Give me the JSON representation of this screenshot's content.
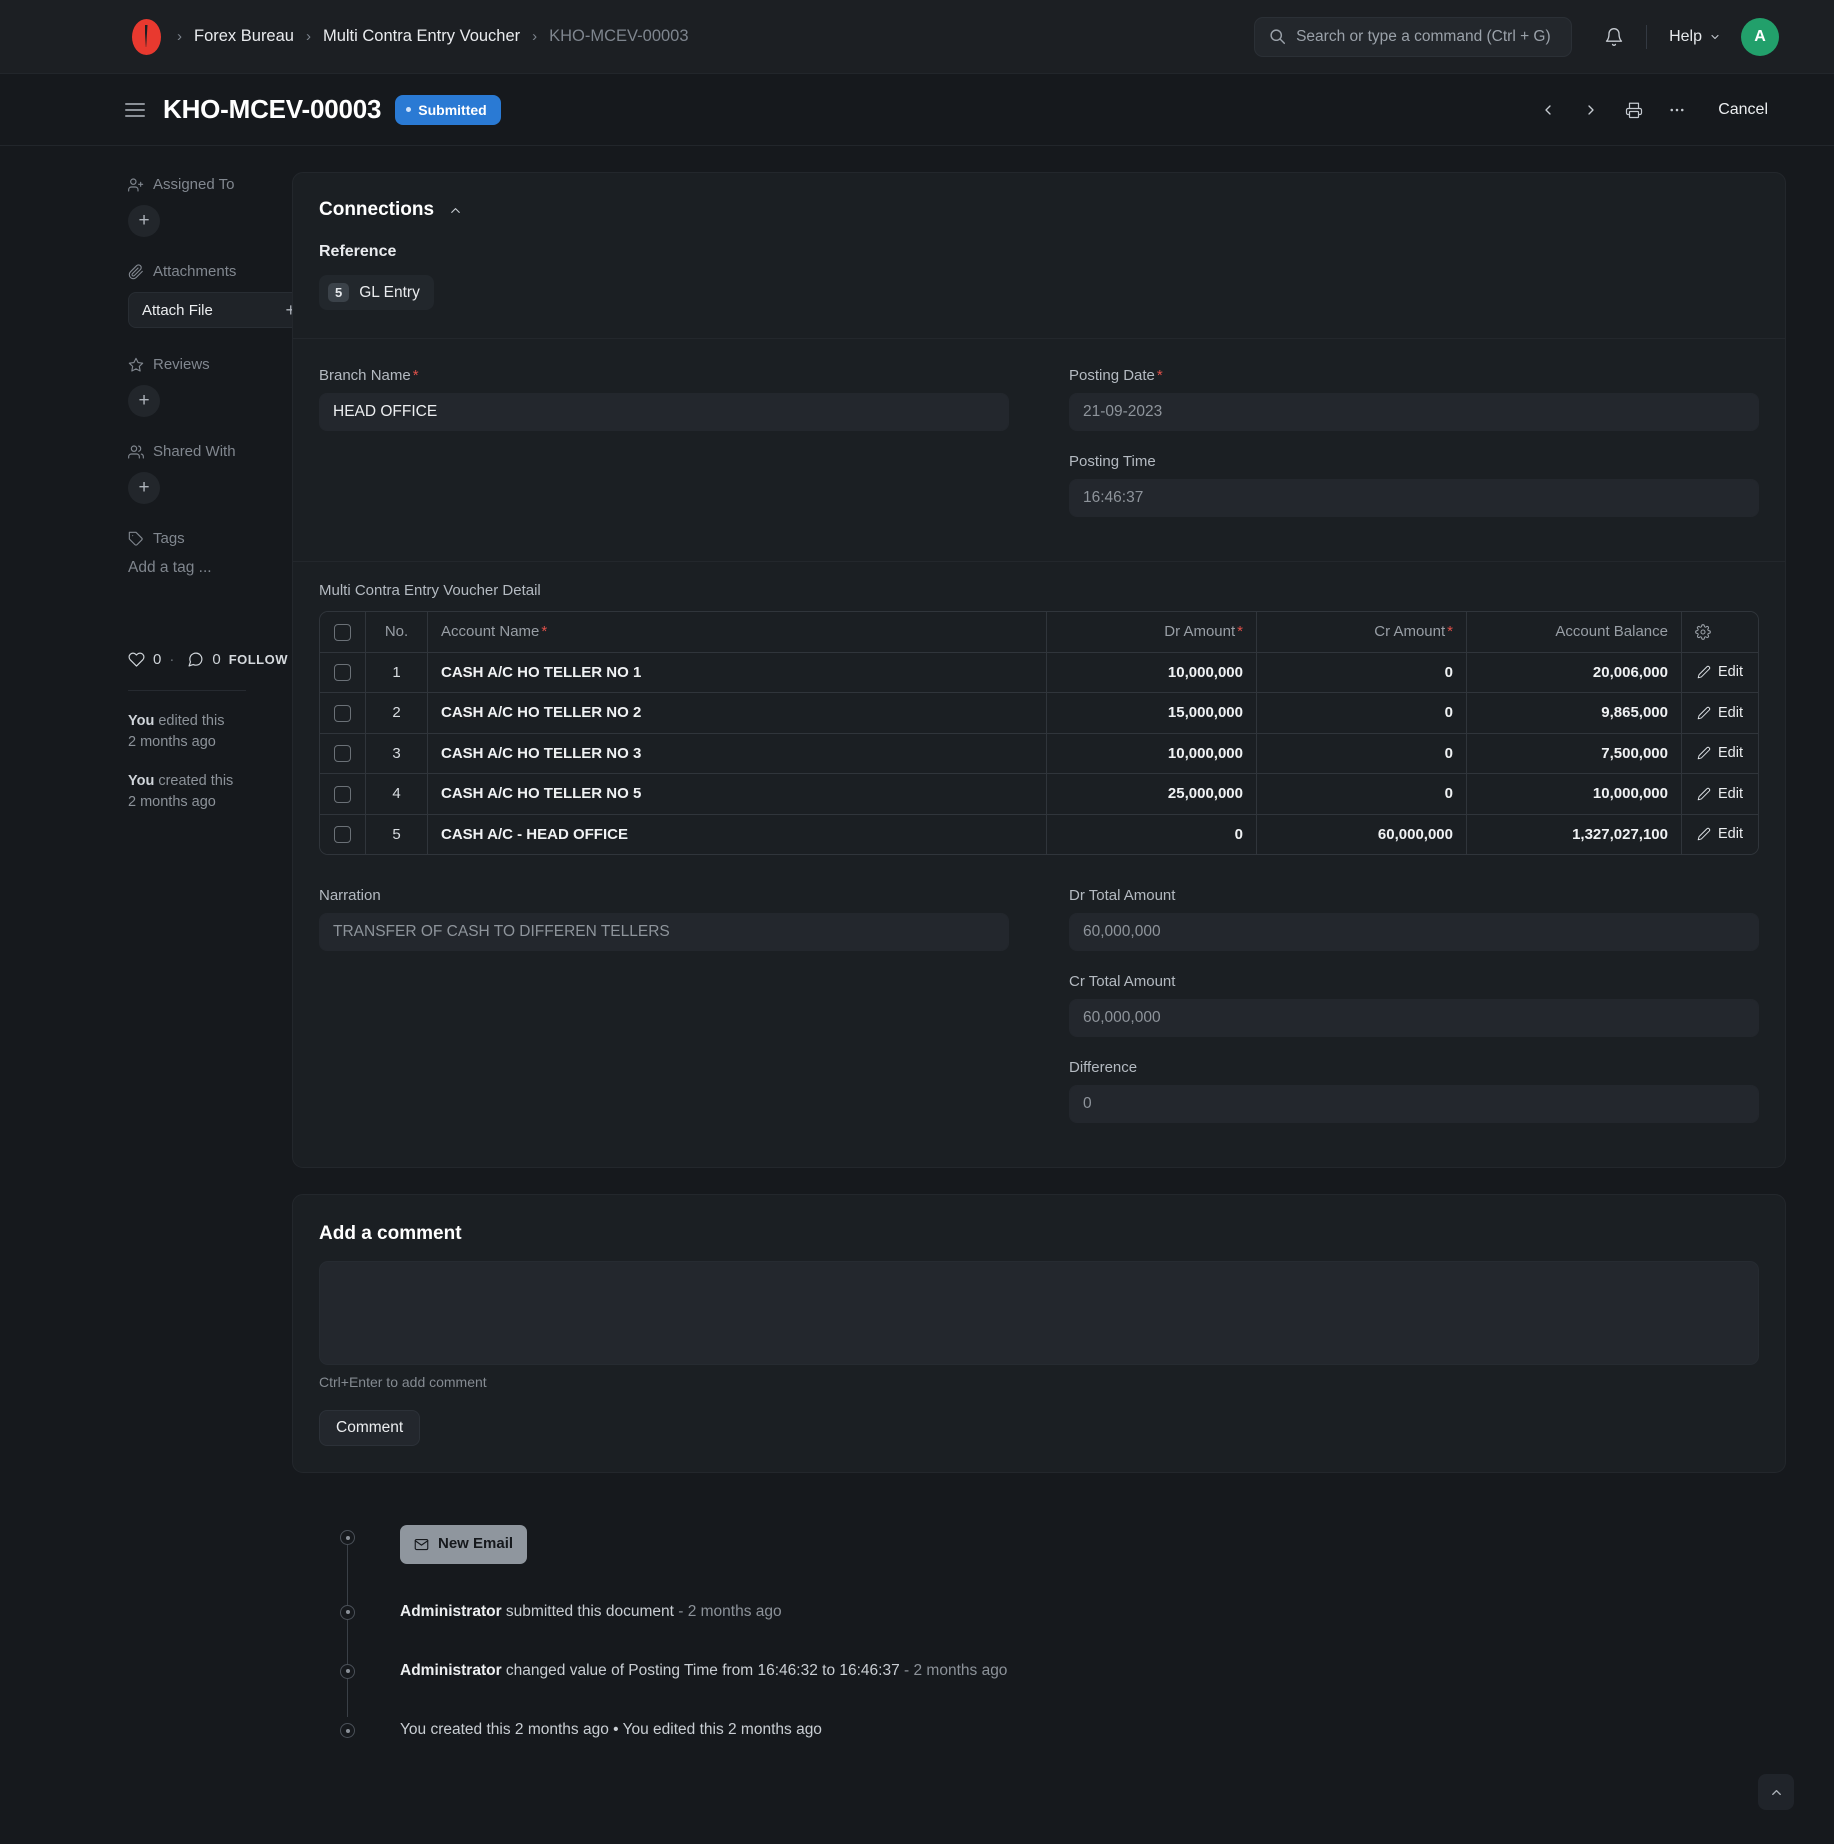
{
  "navbar": {
    "logo_alt": "frappe-logo",
    "breadcrumb": [
      {
        "label": "Forex Bureau",
        "current": false
      },
      {
        "label": "Multi Contra Entry Voucher",
        "current": false
      },
      {
        "label": "KHO-MCEV-00003",
        "current": true
      }
    ],
    "search": {
      "placeholder": "Search or type a command (Ctrl + G)",
      "value": ""
    },
    "help_label": "Help",
    "avatar_initial": "A"
  },
  "page_head": {
    "title": "KHO-MCEV-00003",
    "status": "Submitted",
    "status_color": "#2a7ad4",
    "cancel_label": "Cancel"
  },
  "sidebar": {
    "assigned_to_label": "Assigned To",
    "attachments_label": "Attachments",
    "attach_file_label": "Attach File",
    "reviews_label": "Reviews",
    "shared_with_label": "Shared With",
    "tags_label": "Tags",
    "tag_placeholder": "Add a tag ...",
    "likes_count": "0",
    "comments_count": "0",
    "follow_label": "FOLLOW",
    "activity": [
      {
        "actor": "You",
        "action": "edited this",
        "time": "2 months ago"
      },
      {
        "actor": "You",
        "action": "created this",
        "time": "2 months ago"
      }
    ]
  },
  "connections": {
    "title": "Connections",
    "reference_label": "Reference",
    "links": [
      {
        "count": "5",
        "label": "GL Entry"
      }
    ]
  },
  "form": {
    "branch_name": {
      "label": "Branch Name",
      "required": true,
      "value": "HEAD OFFICE"
    },
    "posting_date": {
      "label": "Posting Date",
      "required": true,
      "value": "21-09-2023"
    },
    "posting_time": {
      "label": "Posting Time",
      "required": false,
      "value": "16:46:37"
    }
  },
  "detail_table": {
    "caption": "Multi Contra Entry Voucher Detail",
    "columns": [
      {
        "key": "check",
        "label": ""
      },
      {
        "key": "no",
        "label": "No."
      },
      {
        "key": "account_name",
        "label": "Account Name",
        "required": true
      },
      {
        "key": "dr_amount",
        "label": "Dr Amount",
        "required": true
      },
      {
        "key": "cr_amount",
        "label": "Cr Amount",
        "required": true
      },
      {
        "key": "account_balance",
        "label": "Account Balance",
        "required": false
      },
      {
        "key": "settings",
        "label": "gear-icon"
      }
    ],
    "edit_label": "Edit",
    "rows": [
      {
        "no": "1",
        "account_name": "CASH A/C HO TELLER NO 1",
        "dr_amount": "10,000,000",
        "cr_amount": "0",
        "account_balance": "20,006,000"
      },
      {
        "no": "2",
        "account_name": "CASH A/C HO TELLER NO 2",
        "dr_amount": "15,000,000",
        "cr_amount": "0",
        "account_balance": "9,865,000"
      },
      {
        "no": "3",
        "account_name": "CASH A/C HO TELLER NO 3",
        "dr_amount": "10,000,000",
        "cr_amount": "0",
        "account_balance": "7,500,000"
      },
      {
        "no": "4",
        "account_name": "CASH A/C HO TELLER NO 5",
        "dr_amount": "25,000,000",
        "cr_amount": "0",
        "account_balance": "10,000,000"
      },
      {
        "no": "5",
        "account_name": "CASH A/C - HEAD OFFICE",
        "dr_amount": "0",
        "cr_amount": "60,000,000",
        "account_balance": "1,327,027,100"
      }
    ]
  },
  "totals": {
    "narration": {
      "label": "Narration",
      "value": "TRANSFER OF CASH TO DIFFEREN TELLERS"
    },
    "dr_total": {
      "label": "Dr Total Amount",
      "value": "60,000,000"
    },
    "cr_total": {
      "label": "Cr Total Amount",
      "value": "60,000,000"
    },
    "difference": {
      "label": "Difference",
      "value": "0"
    }
  },
  "comment": {
    "title": "Add a comment",
    "value": "",
    "hint": "Ctrl+Enter to add comment",
    "button_label": "Comment"
  },
  "timeline": {
    "new_email_label": "New Email",
    "items": [
      {
        "type": "email-button"
      },
      {
        "actor": "Administrator",
        "text": " submitted this document",
        "time": " - 2 months ago"
      },
      {
        "actor": "Administrator",
        "text": " changed value of Posting Time from 16:46:32 to 16:46:37",
        "time": " - 2 months ago"
      },
      {
        "actor": "",
        "text": "You created this 2 months ago • You edited this 2 months ago",
        "time": ""
      }
    ]
  }
}
